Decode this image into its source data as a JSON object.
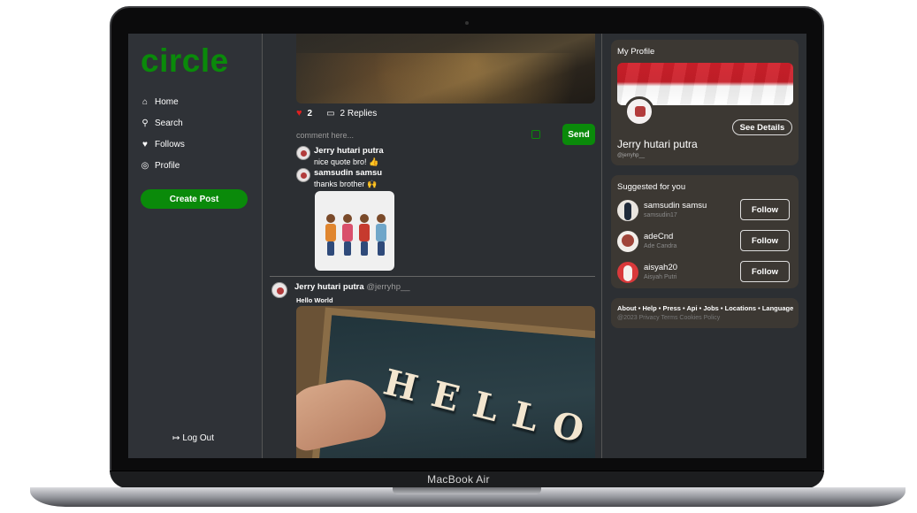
{
  "device": {
    "label": "MacBook Air"
  },
  "sidebar": {
    "logo": "circle",
    "nav": [
      {
        "icon": "home-icon",
        "label": "Home"
      },
      {
        "icon": "search-icon",
        "label": "Search"
      },
      {
        "icon": "heart-icon",
        "label": "Follows"
      },
      {
        "icon": "profile-icon",
        "label": "Profile"
      }
    ],
    "create_post": "Create Post",
    "logout": "Log Out"
  },
  "feed": {
    "post1": {
      "likes": "2",
      "replies": "2 Replies",
      "comment_placeholder": "comment here...",
      "send": "Send",
      "comments": [
        {
          "name": "Jerry hutari putra",
          "text": "nice quote bro! 👍"
        },
        {
          "name": "samsudin samsu",
          "text": "thanks brother 🙌"
        }
      ]
    },
    "post2": {
      "author": "Jerry hutari putra",
      "handle": "@jerryhp__",
      "text": "Hello World",
      "image_word": "HELLO"
    }
  },
  "profile_card": {
    "title": "My Profile",
    "details_button": "See Details",
    "name": "Jerry hutari putra",
    "handle": "@jerryhp__"
  },
  "suggested": {
    "title": "Suggested for you",
    "users": [
      {
        "name": "samsudin samsu",
        "sub": "samsudin17",
        "follow": "Follow"
      },
      {
        "name": "adeCnd",
        "sub": "Ade Candra",
        "follow": "Follow"
      },
      {
        "name": "aisyah20",
        "sub": "Aisyah Putri",
        "follow": "Follow"
      }
    ]
  },
  "footer": {
    "links": "About • Help • Press • Api • Jobs • Locations • Language",
    "copyright": "@2023 Privacy Terms Cookies Policy"
  },
  "colors": {
    "accent": "#0a8a0a",
    "background": "#2c2f33",
    "card": "#3c3833",
    "like": "#e02020"
  }
}
